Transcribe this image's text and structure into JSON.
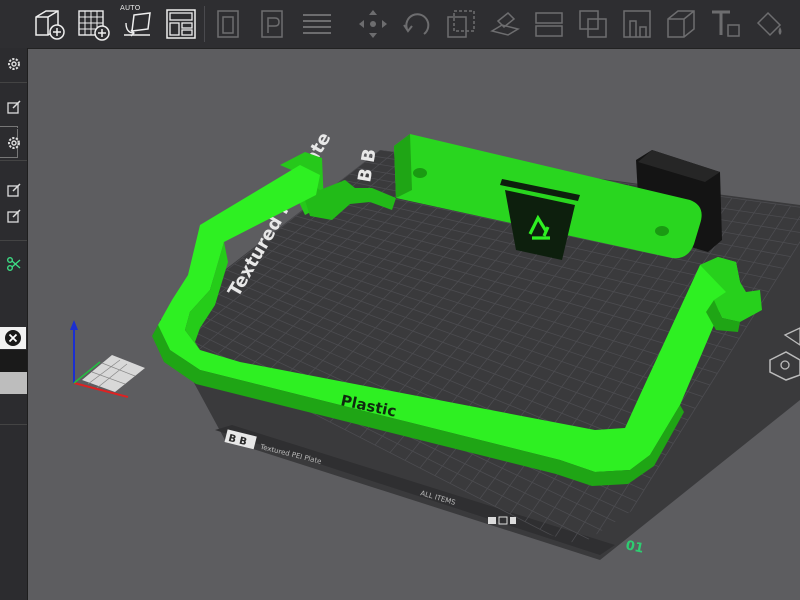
{
  "toolbar": {
    "auto_label": "AUTO",
    "buttons": [
      {
        "name": "add-model-button",
        "icon": "cube-plus-icon"
      },
      {
        "name": "add-plate-button",
        "icon": "grid-plus-icon"
      },
      {
        "name": "auto-orient-button",
        "icon": "auto-orient-icon"
      },
      {
        "name": "arrange-button",
        "icon": "layout-icon"
      },
      {
        "name": "split-objects-button",
        "icon": "split-objects-icon"
      },
      {
        "name": "split-parts-button",
        "icon": "split-parts-icon"
      },
      {
        "name": "layers-button",
        "icon": "layers-icon"
      },
      {
        "name": "move-button",
        "icon": "move-icon"
      },
      {
        "name": "rotate-button",
        "icon": "rotate-icon"
      },
      {
        "name": "scale-button",
        "icon": "scale-icon"
      },
      {
        "name": "lay-on-face-button",
        "icon": "lay-on-face-icon"
      },
      {
        "name": "cut-button",
        "icon": "cut-icon"
      },
      {
        "name": "boolean-button",
        "icon": "boolean-icon"
      },
      {
        "name": "support-paint-button",
        "icon": "support-paint-icon"
      },
      {
        "name": "measure-button",
        "icon": "measure-icon"
      },
      {
        "name": "text-button",
        "icon": "text-shape-icon"
      },
      {
        "name": "color-paint-button",
        "icon": "paint-bucket-icon"
      }
    ]
  },
  "scene": {
    "model_color": "#2ef022",
    "model_shadow": "#1fa515",
    "model_label": "Plastic",
    "plate_number": "01",
    "plate_brand": "Textured PEI Plate",
    "plate_brand_short": "B B",
    "plate_small_text": "Textured PEI Plate",
    "plate_code": "B B",
    "plate_bottom_text": "ALL ITEMS"
  },
  "colors": {
    "background": "#5d5d60",
    "toolbar": "#2e2e31",
    "plate": "#3a3a3c",
    "grid": "#4c4c50",
    "accent_green": "#2ecc71"
  }
}
